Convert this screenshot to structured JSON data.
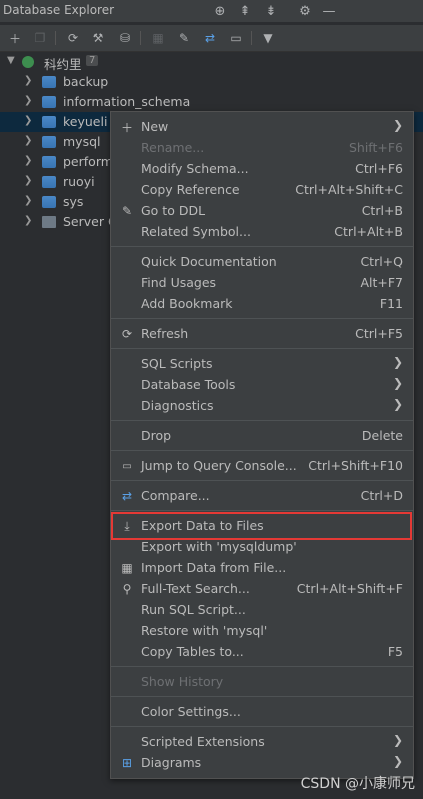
{
  "title": "Database Explorer",
  "tree": {
    "root": {
      "label": "科约里",
      "count": "7"
    },
    "items": [
      {
        "label": "backup"
      },
      {
        "label": "information_schema"
      },
      {
        "label": "keyueli"
      },
      {
        "label": "mysql"
      },
      {
        "label": "perform"
      },
      {
        "label": "ruoyi"
      },
      {
        "label": "sys"
      },
      {
        "label": "Server C"
      }
    ]
  },
  "menu": [
    {
      "label": "New",
      "shortcut": "",
      "submenu": true,
      "icon": "plus-icon"
    },
    {
      "label": "Rename...",
      "shortcut": "Shift+F6",
      "disabled": true
    },
    {
      "label": "Modify Schema...",
      "shortcut": "Ctrl+F6"
    },
    {
      "label": "Copy Reference",
      "shortcut": "Ctrl+Alt+Shift+C"
    },
    {
      "label": "Go to DDL",
      "shortcut": "Ctrl+B",
      "icon": "pencil-icon"
    },
    {
      "label": "Related Symbol...",
      "shortcut": "Ctrl+Alt+B"
    },
    {
      "label": "Quick Documentation",
      "shortcut": "Ctrl+Q"
    },
    {
      "label": "Find Usages",
      "shortcut": "Alt+F7"
    },
    {
      "label": "Add Bookmark",
      "shortcut": "F11"
    },
    {
      "label": "Refresh",
      "shortcut": "Ctrl+F5",
      "icon": "refresh-icon"
    },
    {
      "label": "SQL Scripts",
      "submenu": true
    },
    {
      "label": "Database Tools",
      "submenu": true
    },
    {
      "label": "Diagnostics",
      "submenu": true
    },
    {
      "label": "Drop",
      "shortcut": "Delete"
    },
    {
      "label": "Jump to Query Console...",
      "shortcut": "Ctrl+Shift+F10",
      "icon": "console-icon"
    },
    {
      "label": "Compare...",
      "shortcut": "Ctrl+D",
      "icon": "compare-icon"
    },
    {
      "label": "Export Data to Files",
      "shortcut": "",
      "icon": "download-icon"
    },
    {
      "label": "Export with 'mysqldump'",
      "shortcut": ""
    },
    {
      "label": "Import Data from File...",
      "shortcut": "",
      "icon": "table-icon"
    },
    {
      "label": "Full-Text Search...",
      "shortcut": "Ctrl+Alt+Shift+F",
      "icon": "search-icon"
    },
    {
      "label": "Run SQL Script...",
      "shortcut": ""
    },
    {
      "label": "Restore with 'mysql'",
      "shortcut": ""
    },
    {
      "label": "Copy Tables to...",
      "shortcut": "F5"
    },
    {
      "label": "Show History",
      "shortcut": "",
      "disabled": true
    },
    {
      "label": "Color Settings...",
      "shortcut": ""
    },
    {
      "label": "Scripted Extensions",
      "submenu": true
    },
    {
      "label": "Diagrams",
      "submenu": true,
      "icon": "diagram-icon"
    }
  ],
  "watermark": "CSDN @小康师兄",
  "colors": {
    "highlight_box": "#e53935",
    "selection": "#0d293e"
  }
}
